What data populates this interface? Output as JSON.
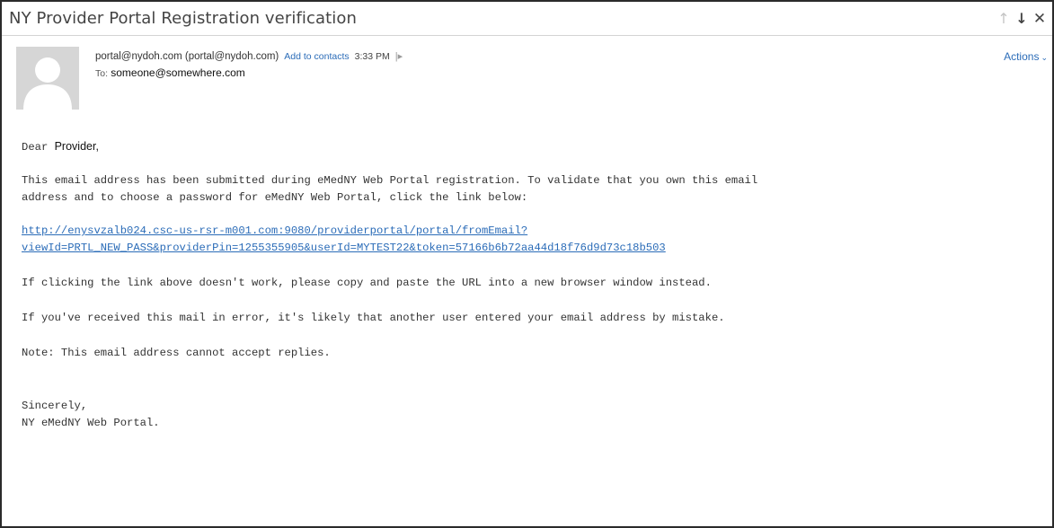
{
  "email": {
    "subject": "NY Provider Portal Registration verification",
    "from": "portal@nydoh.com (portal@nydoh.com)",
    "add_contacts": "Add to contacts",
    "time": "3:33 PM",
    "to_label": "To:",
    "to_value": "someone@somewhere.com",
    "actions_label": "Actions"
  },
  "icons": {
    "prev": "arrow-up-icon",
    "next": "arrow-down-icon",
    "close": "close-icon",
    "flag": "flag-icon",
    "avatar": "person-silhouette"
  },
  "body": {
    "greeting_dear": "Dear",
    "greeting_name": "Provider,",
    "para1_line1": "This email address has been submitted during eMedNY Web Portal registration. To validate that you own this email",
    "para1_line2": "address and to choose a password for eMedNY Web Portal, click the link below:",
    "link_line1": "http://enysvzalb024.csc-us-rsr-m001.com:9080/providerportal/portal/fromEmail?",
    "link_line2": "viewId=PRTL_NEW_PASS&providerPin=1255355905&userId=MYTEST22&token=57166b6b72aa44d18f76d9d73c18b503",
    "para2": "If clicking the link above doesn't work, please copy and paste the URL into a new browser window instead.",
    "para3": "If you've received this mail in error, it's likely that another user entered your email address by mistake.",
    "para4": "Note: This email address cannot accept replies.",
    "closing": "Sincerely,",
    "signature": "NY eMedNY Web Portal."
  },
  "colors": {
    "link": "#2b6cb8",
    "avatar_bg": "#d6d6d6",
    "avatar_fg": "#ffffff",
    "frame_border": "#2b2b2b"
  }
}
